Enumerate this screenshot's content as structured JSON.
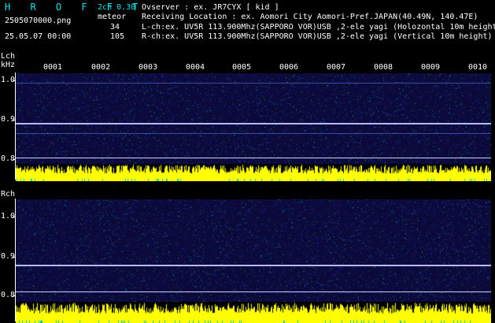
{
  "app": {
    "logo": "H R O F F T",
    "version": "2ch 0.30",
    "filename": "2505070000.png",
    "mode": "meteor",
    "datetime": "25.05.07 00:00",
    "lch_count": "34",
    "rch_count": "105"
  },
  "info": {
    "observer": "Ovserver                : ex. JR7CYX [ kid ]",
    "location": "Receiving Location : ex. Aomori City Aomori-Pref.JAPAN(40.49N, 140.47E)",
    "lch": "L-ch:ex. UV5R 113.900Mhz(SAPPORO VOR)USB ,2-ele yagi (Holozontal 10m height",
    "rch": "R-ch:ex. UV5R 113.900Mhz(SAPPORO VOR)USB ,2-ele yagi (Vertical 10m height)"
  },
  "time_axis": [
    "0001",
    "0002",
    "0003",
    "0004",
    "0005",
    "0006",
    "0007",
    "0008",
    "0009",
    "0010"
  ],
  "lch": {
    "label": "Lch",
    "unit": "kHz",
    "ticks": [
      "1.0",
      "0.9",
      "0.8"
    ]
  },
  "rch": {
    "label": "Rch",
    "ticks": [
      "1.0",
      "0.9",
      "0.8"
    ]
  },
  "colors": {
    "background": "#000000",
    "spectrum_bg": "#0b0a3a",
    "signal_line": "#c8c8ff",
    "amplitude": "#ffff00",
    "cyan_text": "#00e8e8"
  }
}
